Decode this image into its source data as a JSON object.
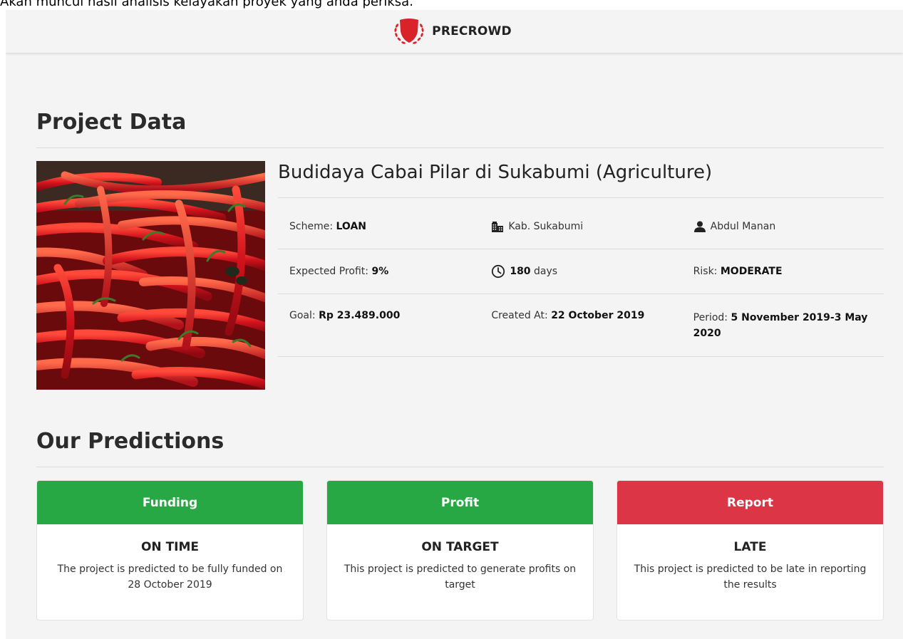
{
  "caption": "Akan muncul hasil analisis kelayakan proyek yang anda periksa.",
  "brand": {
    "name": "PRECROWD",
    "logo_icon": "shield-laurel-icon",
    "logo_color": "#d8232a"
  },
  "project_section": {
    "title": "Project Data"
  },
  "project": {
    "image_icon": "red-chili-photo",
    "title": "Budidaya Cabai Pilar di Sukabumi (Agriculture)",
    "scheme_label": "Scheme:",
    "scheme_value": "LOAN",
    "location": "Kab. Sukabumi",
    "owner": "Abdul Manan",
    "profit_label": "Expected Profit:",
    "profit_value": "9%",
    "duration_value": "180",
    "duration_unit": "days",
    "risk_label": "Risk:",
    "risk_value": "MODERATE",
    "goal_label": "Goal:",
    "goal_value": "Rp 23.489.000",
    "created_label": "Created At:",
    "created_value": "22 October 2019",
    "period_label": "Period:",
    "period_value": "5 November 2019-3 May 2020"
  },
  "predictions_section": {
    "title": "Our Predictions"
  },
  "predictions": [
    {
      "header": "Funding",
      "status": "ON TIME",
      "description": "The project is predicted to be fully funded on 28 October 2019",
      "color": "#28a745"
    },
    {
      "header": "Profit",
      "status": "ON TARGET",
      "description": "This project is predicted to generate profits on target",
      "color": "#28a745"
    },
    {
      "header": "Report",
      "status": "LATE",
      "description": "This project is predicted to be late in reporting the results",
      "color": "#dc3545"
    }
  ]
}
